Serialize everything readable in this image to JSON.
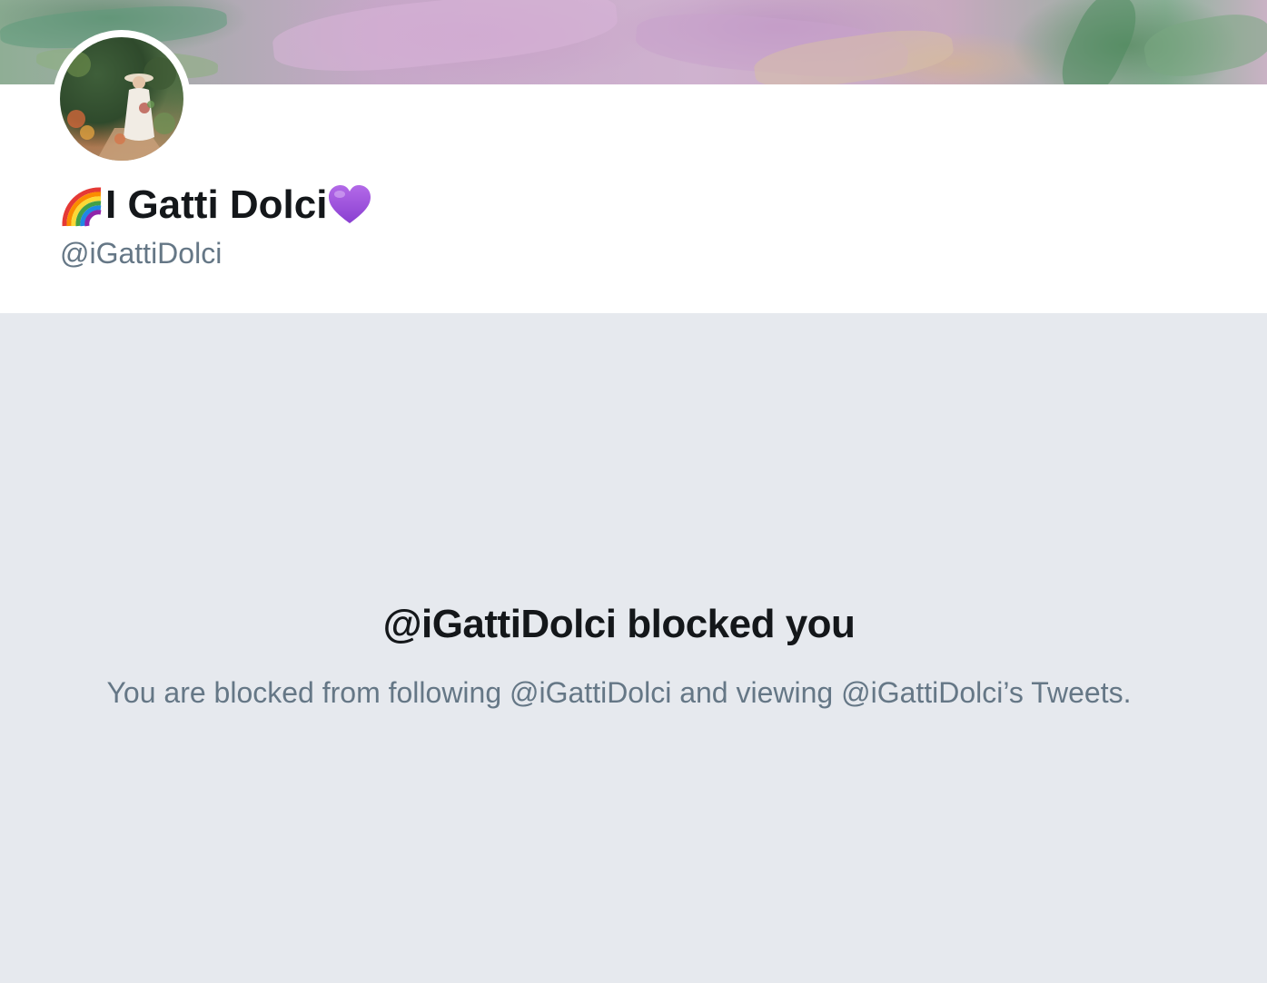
{
  "profile": {
    "name_prefix_emoji": "rainbow-emoji",
    "display_name": "I Gatti Dolci",
    "name_suffix_emoji": "purple-heart-emoji",
    "handle": "@iGattiDolci"
  },
  "blocked": {
    "title": "@iGattiDolci blocked you",
    "description": "You are blocked from following @iGattiDolci and viewing @iGattiDolci’s Tweets."
  },
  "colors": {
    "name_text": "#14171a",
    "secondary_text": "#657786",
    "blocked_background": "#e6e9ee",
    "profile_background": "#ffffff"
  }
}
